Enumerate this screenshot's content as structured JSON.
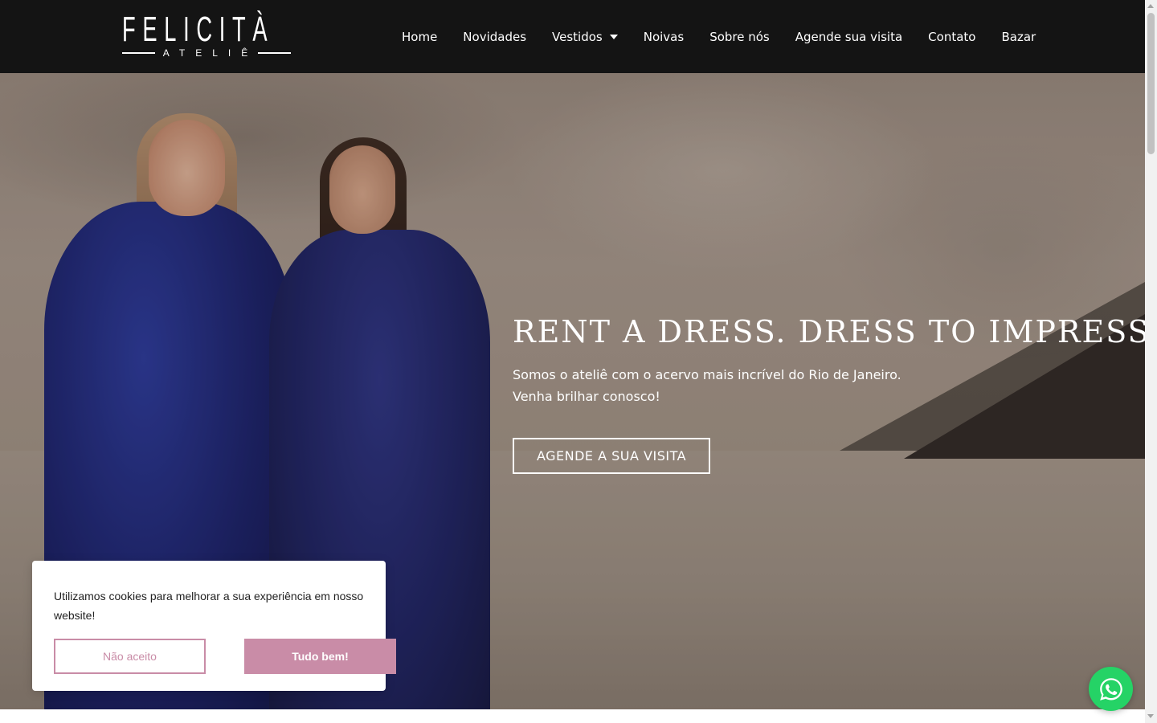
{
  "header": {
    "logo": {
      "main": "FELICITÀ",
      "sub": "ATELIÊ"
    },
    "nav": [
      {
        "label": "Home"
      },
      {
        "label": "Novidades"
      },
      {
        "label": "Vestidos",
        "has_dropdown": true
      },
      {
        "label": "Noivas"
      },
      {
        "label": "Sobre nós"
      },
      {
        "label": "Agende sua visita"
      },
      {
        "label": "Contato"
      },
      {
        "label": "Bazar"
      }
    ]
  },
  "hero": {
    "title": "RENT A DRESS. DRESS TO IMPRESS.",
    "line1": "Somos o ateliê com o acervo mais incrível do Rio de Janeiro.",
    "line2": "Venha brilhar conosco!",
    "cta": "AGENDE A SUA VISITA"
  },
  "cookie_banner": {
    "message": "Utilizamos cookies para melhorar a sua experiência em nosso website!",
    "decline": "Não aceito",
    "accept": "Tudo bem!"
  },
  "colors": {
    "header_bg": "#141414",
    "accent_pink": "#c98ca7",
    "whatsapp": "#25d366"
  },
  "icons": {
    "whatsapp": "whatsapp-icon",
    "dropdown": "chevron-down-icon"
  }
}
